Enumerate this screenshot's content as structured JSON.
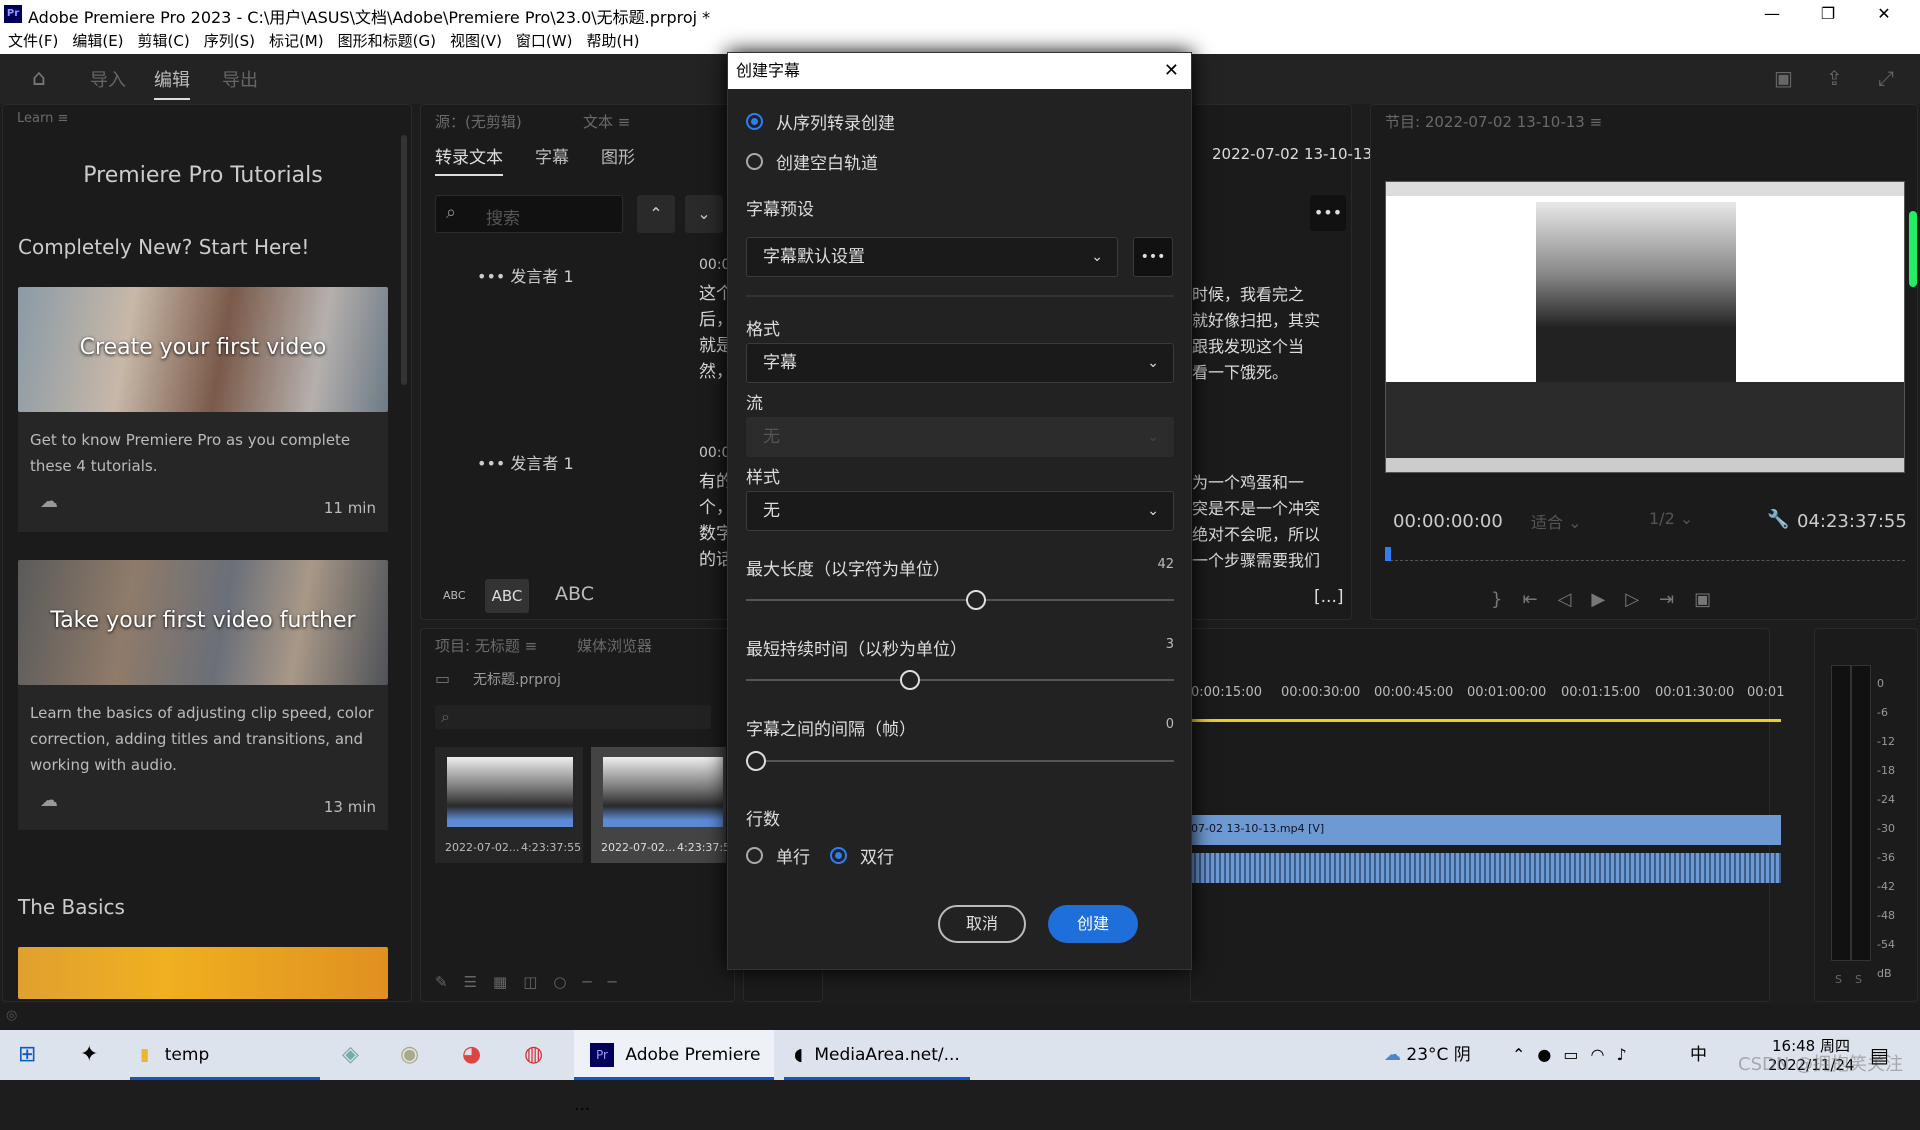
{
  "window": {
    "title": "Adobe Premiere Pro 2023 - C:\\用户\\ASUS\\文档\\Adobe\\Premiere Pro\\23.0\\无标题.prproj *",
    "app_icon": "Pr"
  },
  "menu": [
    "文件(F)",
    "编辑(E)",
    "剪辑(C)",
    "序列(S)",
    "标记(M)",
    "图形和标题(G)",
    "视图(V)",
    "窗口(W)",
    "帮助(H)"
  ],
  "header": {
    "tabs": [
      "导入",
      "编辑",
      "导出"
    ],
    "active_tab": "编辑"
  },
  "learn": {
    "panel_label": "Learn",
    "title": "Premiere Pro Tutorials",
    "section1": "Completely New? Start Here!",
    "cards": [
      {
        "title": "Create your first video",
        "desc": "Get to know Premiere Pro as you complete these 4 tutorials.",
        "duration": "11 min"
      },
      {
        "title": "Take your first video further",
        "desc": "Learn the basics of adjusting clip speed, color correction, adding titles and transitions, and working with audio.",
        "duration": "13 min"
      }
    ],
    "section2": "The Basics"
  },
  "text_panel": {
    "source_label": "源：(无剪辑)",
    "tab_label": "文本",
    "tabs": [
      "转录文本",
      "字幕",
      "图形"
    ],
    "search_placeholder": "搜索",
    "speakers": [
      {
        "name": "发言者 1",
        "time": "00:0",
        "lines": [
          "这个",
          "后，",
          "就是",
          "然，"
        ]
      },
      {
        "name": "发言者 1",
        "time": "00:0",
        "lines": [
          "有的",
          "个，",
          "数字",
          "的话"
        ]
      }
    ],
    "case_buttons": [
      "ABC",
      "ABC",
      "ABC"
    ]
  },
  "transcript_right": {
    "timestamp": "2022-07-02 13-10-13",
    "block1": [
      "时候，我看完之",
      "就好像扫把，其实",
      "跟我发现这个当",
      "看一下饿死。"
    ],
    "block2": [
      "为一个鸡蛋和一",
      "突是不是一个冲突",
      "绝对不会呢，所以",
      "一个步骤需要我们"
    ],
    "bracket": "[...]"
  },
  "program": {
    "label": "节目: 2022-07-02 13-10-13",
    "timecode_left": "00:00:00:00",
    "fit": "适合",
    "resolution": "1/2",
    "timecode_right": "04:23:37:55"
  },
  "project": {
    "label": "项目: 无标题",
    "media_browser": "媒体浏览器",
    "file": "无标题.prproj",
    "clips": [
      {
        "name": "2022-07-02...",
        "duration": "4:23:37:55"
      },
      {
        "name": "2022-07-02...",
        "duration": "4:23:37:55"
      }
    ]
  },
  "timeline": {
    "ruler": [
      "0:00:15:00",
      "00:00:30:00",
      "00:00:45:00",
      "00:01:00:00",
      "00:01:15:00",
      "00:01:30:00",
      "00:01"
    ],
    "clip_label": "07-02 13-10-13.mp4 [V]"
  },
  "meter": {
    "ticks": [
      "0",
      "-6",
      "-12",
      "-18",
      "-24",
      "-30",
      "-36",
      "-42",
      "-48",
      "-54",
      "dB"
    ],
    "solo": [
      "S",
      "S"
    ]
  },
  "dialog": {
    "title": "创建字幕",
    "opt_from_transcript": "从序列转录创建",
    "opt_blank": "创建空白轨道",
    "preset_label": "字幕预设",
    "preset_value": "字幕默认设置",
    "format_label": "格式",
    "format_value": "字幕",
    "stream_label": "流",
    "stream_value": "无",
    "style_label": "样式",
    "style_value": "无",
    "max_length_label": "最大长度（以字符为单位）",
    "max_length_value": "42",
    "min_duration_label": "最短持续时间（以秒为单位）",
    "min_duration_value": "3",
    "gap_label": "字幕之间的间隔（帧）",
    "gap_value": "0",
    "lines_label": "行数",
    "single": "单行",
    "double": "双行",
    "cancel": "取消",
    "create": "创建"
  },
  "taskbar": {
    "items": [
      "temp",
      "Adobe Premiere ...",
      "MediaArea.net/..."
    ],
    "weather": "23°C 阴",
    "ime": "中",
    "time": "16:48 周四",
    "date": "2022/11/24",
    "watermark": "CSDN @拥抱笑关注"
  },
  "colors": {
    "accent": "#2e7cf6",
    "clip": "#6e9ad4",
    "bg": "#1d1d1d"
  }
}
